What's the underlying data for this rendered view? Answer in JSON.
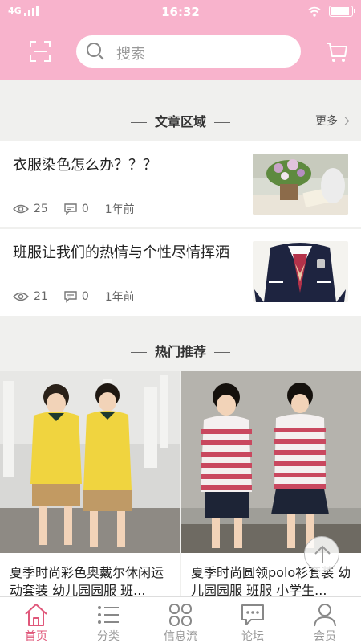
{
  "status_bar": {
    "network": "4G",
    "time": "16:32",
    "battery_level": 0.9
  },
  "search": {
    "placeholder": "搜索"
  },
  "articles_section": {
    "title": "文章区域",
    "more": "更多",
    "items": [
      {
        "title": "衣服染色怎么办？？？",
        "views": "25",
        "comments": "0",
        "time": "1年前"
      },
      {
        "title": "班服让我们的热情与个性尽情挥洒",
        "views": "21",
        "comments": "0",
        "time": "1年前"
      }
    ]
  },
  "hot_section": {
    "title": "热门推荐",
    "products": [
      {
        "name": "夏季时尚彩色奥戴尔休闲运动套装 幼儿园园服 班..."
      },
      {
        "name": "夏季时尚圆领polo衫套装 幼儿园园服 班服 小学生..."
      }
    ]
  },
  "tabbar": {
    "items": [
      {
        "label": "首页",
        "icon": "home-icon",
        "active": true
      },
      {
        "label": "分类",
        "icon": "list-icon",
        "active": false
      },
      {
        "label": "信息流",
        "icon": "grid-icon",
        "active": false
      },
      {
        "label": "论坛",
        "icon": "chat-icon",
        "active": false
      },
      {
        "label": "会员",
        "icon": "user-icon",
        "active": false
      }
    ]
  },
  "colors": {
    "header": "#f8b3cc",
    "accent": "#e0577a",
    "background": "#f0f0ee"
  }
}
